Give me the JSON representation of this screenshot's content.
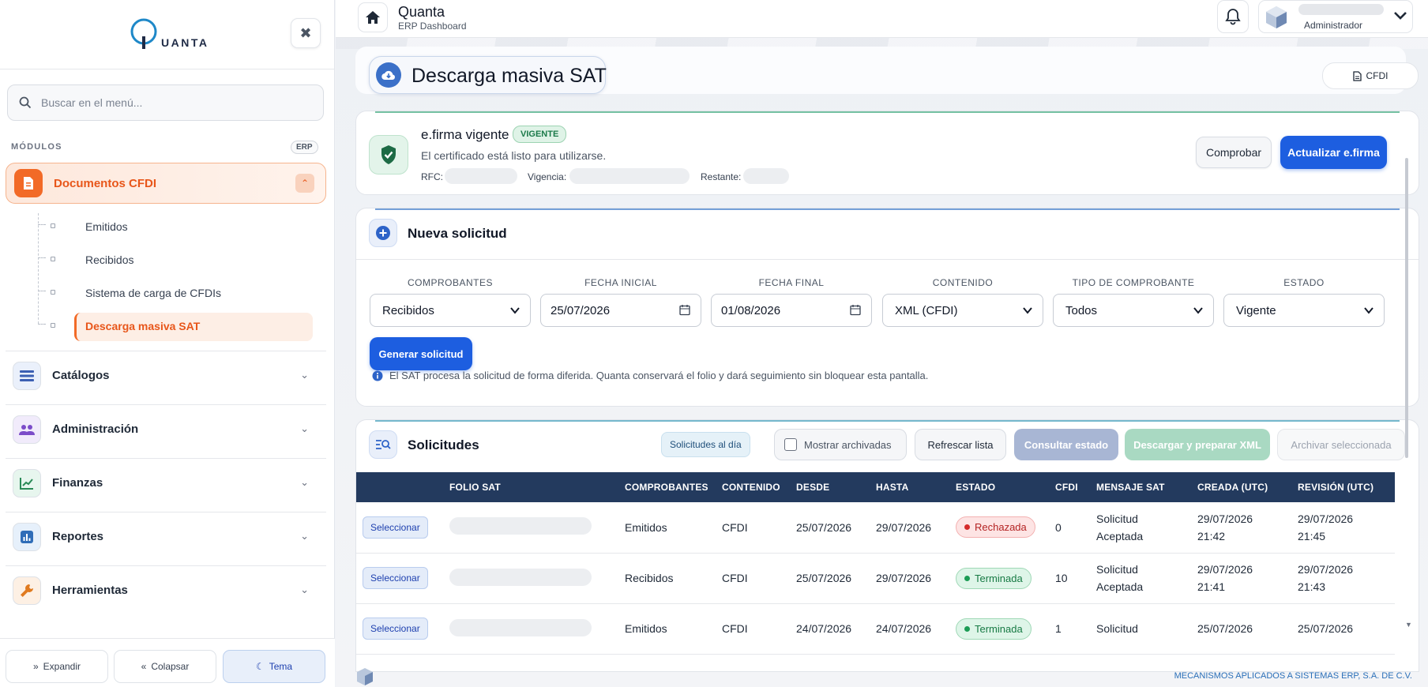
{
  "sidebar": {
    "logo_text": "UANTA",
    "search_placeholder": "Buscar en el menú...",
    "modules_heading": "MÓDULOS",
    "modules_badge": "ERP",
    "active_group": {
      "label": "Documentos CFDI",
      "items": [
        {
          "label": "Emitidos"
        },
        {
          "label": "Recibidos"
        },
        {
          "label": "Sistema de carga de CFDIs"
        },
        {
          "label": "Descarga masiva SAT",
          "active": true
        }
      ]
    },
    "groups": [
      {
        "label": "Catálogos",
        "icon": "catalog-icon"
      },
      {
        "label": "Administración",
        "icon": "users-icon"
      },
      {
        "label": "Finanzas",
        "icon": "chart-line-icon"
      },
      {
        "label": "Reportes",
        "icon": "report-icon"
      },
      {
        "label": "Herramientas",
        "icon": "wrench-icon"
      }
    ],
    "bottom": {
      "expand": "Expandir",
      "collapse": "Colapsar",
      "theme": "Tema"
    }
  },
  "topbar": {
    "app_title": "Quanta",
    "app_subtitle": "ERP Dashboard",
    "user_role": "Administrador"
  },
  "page": {
    "title": "Descarga masiva SAT",
    "cfdi_button": "CFDI"
  },
  "efirma": {
    "title": "e.firma vigente",
    "badge": "VIGENTE",
    "description": "El certificado está listo para utilizarse.",
    "rfc_label": "RFC:",
    "vigencia_label": "Vigencia:",
    "restante_label": "Restante:",
    "check_button": "Comprobar",
    "update_button": "Actualizar e.firma"
  },
  "nueva_solicitud": {
    "title": "Nueva solicitud",
    "fields": [
      {
        "label": "COMPROBANTES",
        "value": "Recibidos",
        "kind": "select"
      },
      {
        "label": "FECHA INICIAL",
        "value": "25/07/2026",
        "kind": "date"
      },
      {
        "label": "FECHA FINAL",
        "value": "01/08/2026",
        "kind": "date"
      },
      {
        "label": "CONTENIDO",
        "value": "XML (CFDI)",
        "kind": "select"
      },
      {
        "label": "TIPO DE COMPROBANTE",
        "value": "Todos",
        "kind": "select"
      },
      {
        "label": "ESTADO",
        "value": "Vigente",
        "kind": "select"
      }
    ],
    "generate_button": "Generar solicitud",
    "note": "El SAT procesa la solicitud de forma diferida. Quanta conservará el folio y dará seguimiento sin bloquear esta pantalla."
  },
  "solicitudes": {
    "title": "Solicitudes",
    "chip": "Solicitudes al día",
    "show_archived": "Mostrar archivadas",
    "refresh": "Refrescar lista",
    "consult": "Consultar estado",
    "download": "Descargar y preparar XML",
    "archive": "Archivar seleccionada",
    "columns": [
      "",
      "FOLIO SAT",
      "COMPROBANTES",
      "CONTENIDO",
      "DESDE",
      "HASTA",
      "ESTADO",
      "CFDI",
      "MENSAJE SAT",
      "CREADA (UTC)",
      "REVISIÓN (UTC)"
    ],
    "select_label": "Seleccionar",
    "rows": [
      {
        "comprobantes": "Emitidos",
        "contenido": "CFDI",
        "desde": "25/07/2026",
        "hasta": "29/07/2026",
        "estado": "Rechazada",
        "estado_color": "red",
        "cfdi": "0",
        "mensaje_1": "Solicitud",
        "mensaje_2": "Aceptada",
        "creada_1": "29/07/2026",
        "creada_2": "21:42",
        "revision_1": "29/07/2026",
        "revision_2": "21:45"
      },
      {
        "comprobantes": "Recibidos",
        "contenido": "CFDI",
        "desde": "25/07/2026",
        "hasta": "29/07/2026",
        "estado": "Terminada",
        "estado_color": "green",
        "cfdi": "10",
        "mensaje_1": "Solicitud",
        "mensaje_2": "Aceptada",
        "creada_1": "29/07/2026",
        "creada_2": "21:41",
        "revision_1": "29/07/2026",
        "revision_2": "21:43"
      },
      {
        "comprobantes": "Emitidos",
        "contenido": "CFDI",
        "desde": "24/07/2026",
        "hasta": "24/07/2026",
        "estado": "Terminada",
        "estado_color": "green",
        "cfdi": "1",
        "mensaje_1": "Solicitud",
        "mensaje_2": "",
        "creada_1": "25/07/2026",
        "creada_2": "",
        "revision_1": "25/07/2026",
        "revision_2": ""
      }
    ]
  },
  "footer": {
    "company": "MECANISMOS APLICADOS A SISTEMAS ERP, S.A. DE C.V."
  },
  "colors": {
    "accent_orange": "#f26a27",
    "primary_blue": "#1d5ee0",
    "table_header": "#233a5e",
    "status_red": "#b42323",
    "status_green": "#177a44"
  }
}
